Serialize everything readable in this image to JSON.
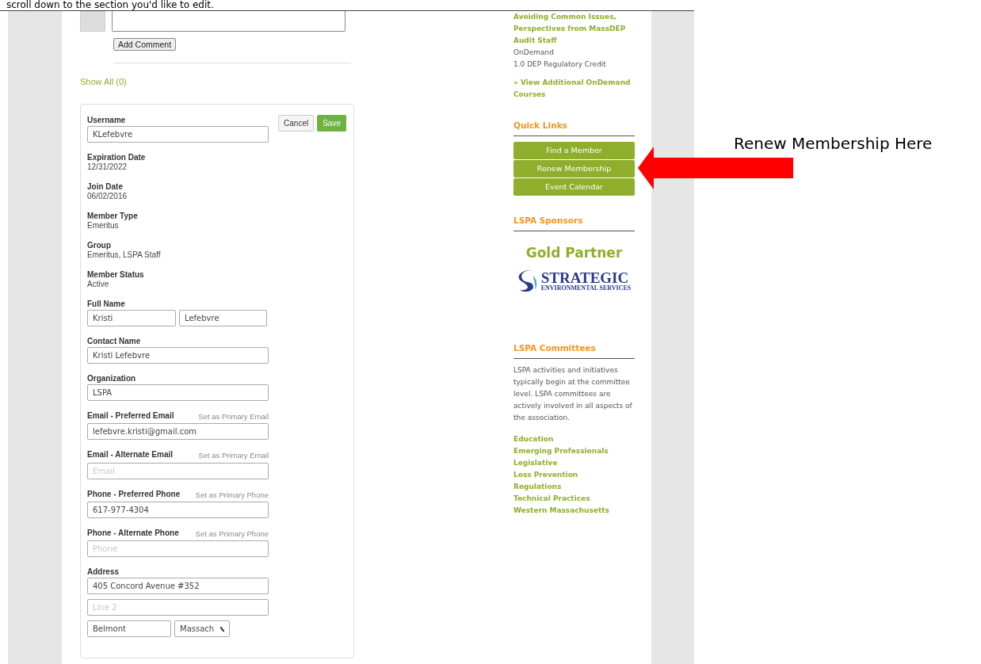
{
  "instruction": "scroll down to the section you'd like to edit.",
  "comment": {
    "button": "Add Comment",
    "show_all": "Show All (0)"
  },
  "profile_form": {
    "buttons": [
      {
        "label": "Cancel",
        "kind": "secondary"
      },
      {
        "label": "Save",
        "kind": "primary"
      }
    ],
    "fields": [
      {
        "kind": "input",
        "label": "Username",
        "rows": [
          [
            {
              "value": "KLefebvre"
            }
          ]
        ]
      },
      {
        "kind": "static",
        "label": "Expiration Date",
        "value": "12/31/2022"
      },
      {
        "kind": "static",
        "label": "Join Date",
        "value": "06/02/2016"
      },
      {
        "kind": "static",
        "label": "Member Type",
        "value": "Emeritus"
      },
      {
        "kind": "static",
        "label": "Group",
        "value": "Emeritus, LSPA Staff"
      },
      {
        "kind": "static",
        "label": "Member Status",
        "value": "Active"
      },
      {
        "kind": "input",
        "label": "Full Name",
        "rows": [
          [
            {
              "value": "Kristi"
            },
            {
              "value": "Lefebvre"
            }
          ]
        ]
      },
      {
        "kind": "input",
        "label": "Contact Name",
        "rows": [
          [
            {
              "value": "Kristi Lefebvre"
            }
          ]
        ]
      },
      {
        "kind": "input",
        "label": "Organization",
        "rows": [
          [
            {
              "value": "LSPA"
            }
          ]
        ]
      },
      {
        "kind": "input",
        "label": "Email - Preferred Email",
        "action": "Set as Primary Email",
        "rows": [
          [
            {
              "value": "lefebvre.kristi@gmail.com"
            }
          ]
        ]
      },
      {
        "kind": "input",
        "label": "Email - Alternate Email",
        "action": "Set as Primary Email",
        "rows": [
          [
            {
              "placeholder": "Email"
            }
          ]
        ]
      },
      {
        "kind": "input",
        "label": "Phone - Preferred Phone",
        "action": "Set as Primary Phone",
        "rows": [
          [
            {
              "value": "617-977-4304"
            }
          ]
        ]
      },
      {
        "kind": "input",
        "label": "Phone - Alternate Phone",
        "action": "Set as Primary Phone",
        "rows": [
          [
            {
              "placeholder": "Phone"
            }
          ]
        ]
      },
      {
        "kind": "input",
        "label": "Address",
        "rows": [
          [
            {
              "value": "405 Concord Avenue #352"
            }
          ],
          [
            {
              "placeholder": "Line 2"
            }
          ],
          [
            {
              "value": "Belmont"
            },
            {
              "value": "Massach",
              "kind": "select"
            }
          ]
        ]
      }
    ]
  },
  "sidebar": {
    "course": {
      "title": "Avoiding Common Issues, Perspectives from MassDEP Audit Staff",
      "lines": [
        "OnDemand",
        "1.0 DEP Regulatory Credit"
      ]
    },
    "view_more": "» View Additional OnDemand Courses",
    "quick_links": {
      "title": "Quick Links",
      "buttons": [
        "Find a Member",
        "Renew Membership",
        "Event Calendar"
      ]
    },
    "sponsors": {
      "title": "LSPA Sponsors",
      "tier": "Gold Partner",
      "logo": {
        "name": "STRATEGIC",
        "tagline": "ENVIRONMENTAL SERVICES"
      }
    },
    "committees": {
      "title": "LSPA Committees",
      "text": "LSPA activities and initiatives typically begin at the committee level. LSPA committees are actively involved in all aspects of the association.",
      "links": [
        "Education",
        "Emerging Professionals",
        "Legislative",
        "Loss Prevention",
        "Regulations",
        "Technical Practices",
        "Western Massachusetts"
      ]
    }
  },
  "annotation": {
    "text": "Renew Membership Here"
  }
}
